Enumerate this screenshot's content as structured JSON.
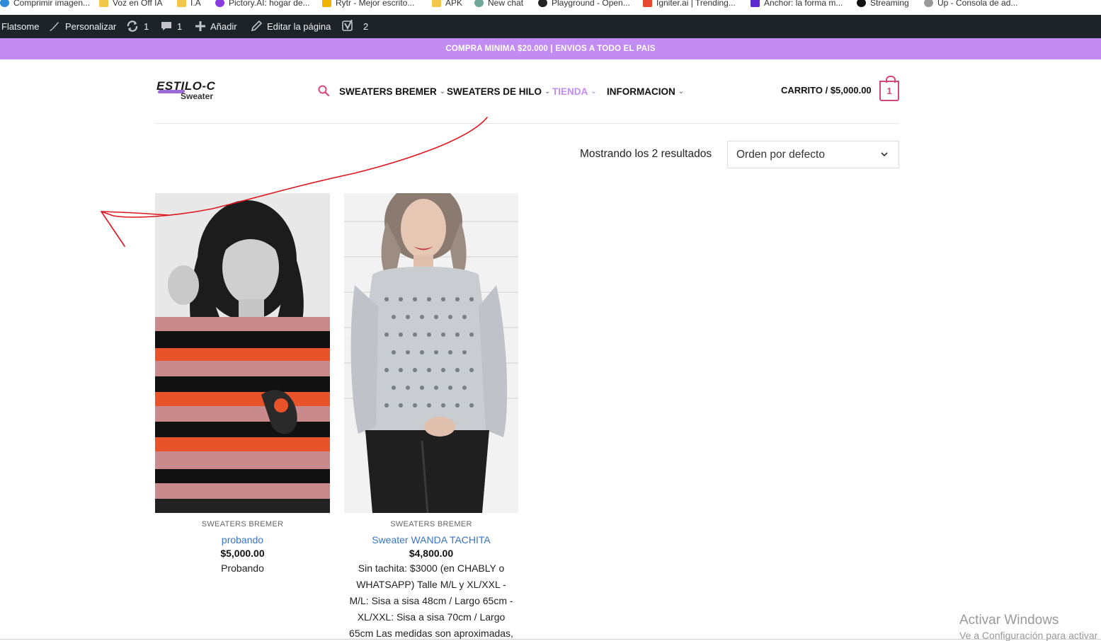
{
  "bookmarks": [
    {
      "label": "Comprimir imagen...",
      "icon": "compress-icon",
      "color": "#2e8bd8"
    },
    {
      "label": "Voz en Off IA",
      "icon": "folder-icon",
      "color": "#f3c74a"
    },
    {
      "label": "I.A",
      "icon": "folder-icon",
      "color": "#f3c74a"
    },
    {
      "label": "Pictory.AI: hogar de...",
      "icon": "pictory-icon",
      "color": "#8a3be0"
    },
    {
      "label": "Rytr - Mejor escrito...",
      "icon": "rytr-icon",
      "color": "#f0b200"
    },
    {
      "label": "APK",
      "icon": "folder-icon",
      "color": "#f3c74a"
    },
    {
      "label": "New chat",
      "icon": "openai-icon",
      "color": "#6fa89a"
    },
    {
      "label": "Playground - Open...",
      "icon": "openai-icon",
      "color": "#222222"
    },
    {
      "label": "Igniter.ai | Trending...",
      "icon": "igniter-icon",
      "color": "#e8472f"
    },
    {
      "label": "Anchor: la forma m...",
      "icon": "anchor-icon",
      "color": "#5b2bd0"
    },
    {
      "label": "Streaming",
      "icon": "streaming-icon",
      "color": "#111111"
    },
    {
      "label": "Up - Consola de ad...",
      "icon": "up-icon",
      "color": "#777777"
    }
  ],
  "adminbar": {
    "site": "Flatsome",
    "customize": "Personalizar",
    "updates_count": "1",
    "comments_count": "1",
    "add_new": "Añadir",
    "edit_page": "Editar la página",
    "yoast_count": "2"
  },
  "promo": "COMPRA MINIMA $20.000 | ENVIOS A TODO EL PAIS",
  "logo": {
    "line1": "ESTILO-C",
    "line2": "Sweater"
  },
  "nav": {
    "items": [
      {
        "label": "SWEATERS BREMER"
      },
      {
        "label": "SWEATERS DE HILO"
      },
      {
        "label": "TIENDA"
      },
      {
        "label": "INFORMACION"
      }
    ]
  },
  "cart": {
    "label": "CARRITO / $5,000.00",
    "count": "1"
  },
  "shop": {
    "results": "Mostrando los 2 resultados",
    "sort_selected": "Orden por defecto"
  },
  "products": [
    {
      "category": "SWEATERS BREMER",
      "name": "probando",
      "price": "$5,000.00",
      "desc": "Probando"
    },
    {
      "category": "SWEATERS BREMER",
      "name": "Sweater WANDA TACHITA",
      "price": "$4,800.00",
      "desc_lines": [
        "Sin tachita: $3000 (en CHABLY o",
        "WHATSAPP) Talle M/L y XL/XXL -",
        "M/L: Sisa a sisa 48cm / Largo 65cm -",
        "XL/XXL: Sisa a sisa 70cm / Largo",
        "65cm Las medidas son aproximadas,"
      ]
    }
  ],
  "windows": {
    "line1": "Activar Windows",
    "line2": "Ve a Configuración para activar"
  },
  "colors": {
    "accent": "#c38cf2",
    "cart": "#d4477a",
    "link": "#3a74c4",
    "adminbar": "#1d2327"
  }
}
